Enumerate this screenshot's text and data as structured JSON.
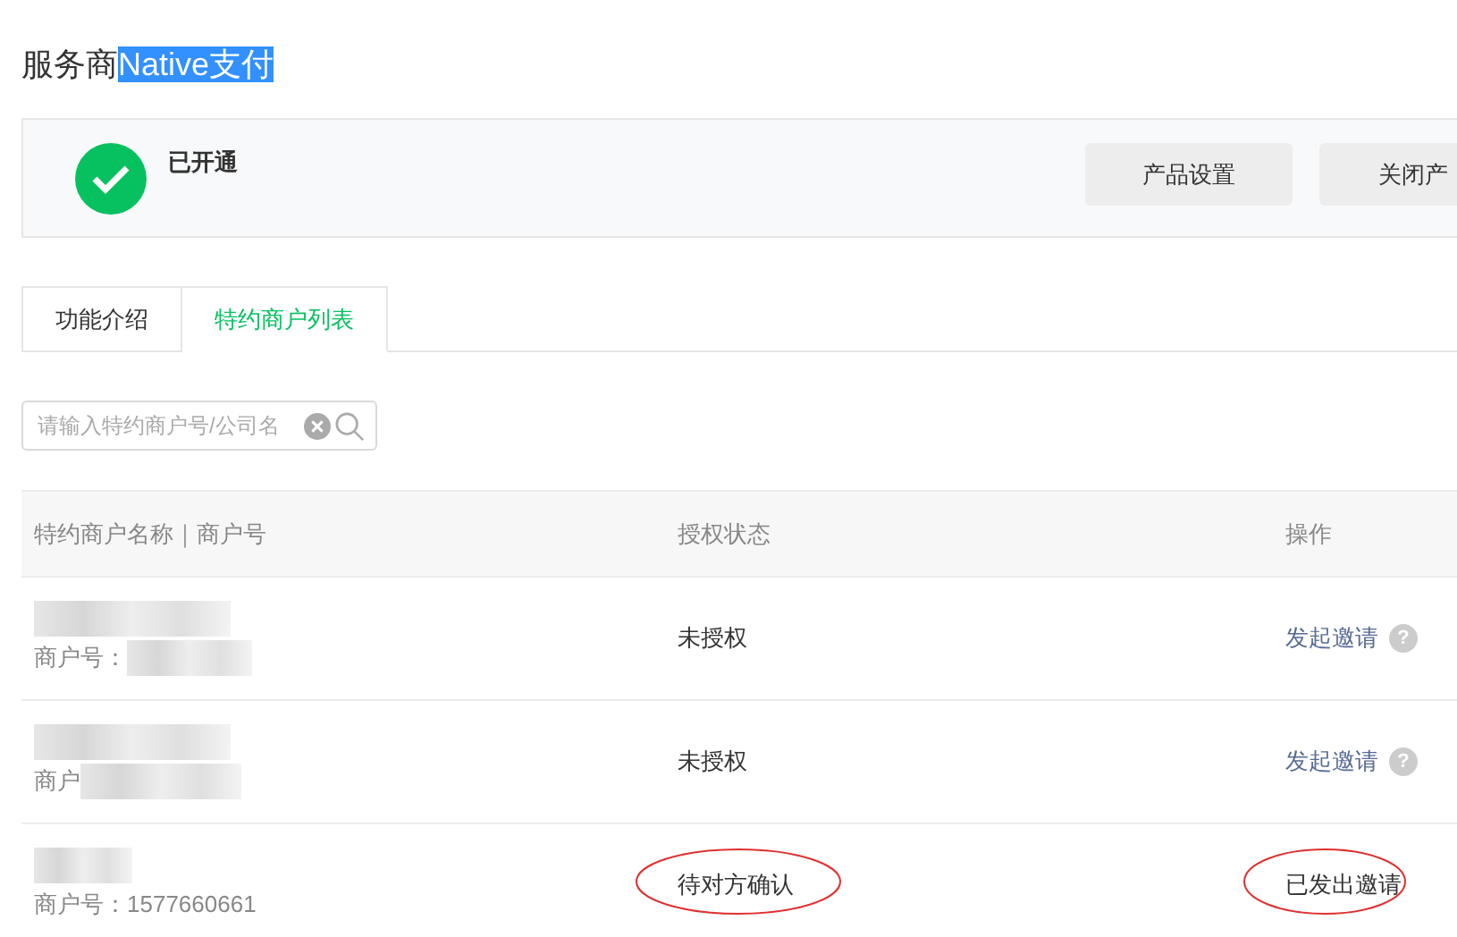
{
  "page_title": {
    "prefix": "服务商",
    "highlighted": "Native支付"
  },
  "status_panel": {
    "status": "已开通",
    "active": true,
    "buttons": [
      "产品设置",
      "关闭产"
    ]
  },
  "tabs": [
    {
      "label": "功能介绍",
      "selected": false
    },
    {
      "label": "特约商户列表",
      "selected": true
    }
  ],
  "search": {
    "placeholder": "请输入特约商户号/公司名"
  },
  "table": {
    "columns": [
      "特约商户名称｜商户号",
      "授权状态",
      "操作"
    ],
    "rows": [
      {
        "merchant_id": "商户号：",
        "status": "未授权",
        "action": {
          "kind": "link",
          "label": "发起邀请",
          "help": "?"
        },
        "circled": false
      },
      {
        "merchant_id": "商户",
        "status": "未授权",
        "action": {
          "kind": "link",
          "label": "发起邀请",
          "help": "?"
        },
        "circled": false
      },
      {
        "merchant_id": "商户号：1577660661",
        "status": "待对方确认",
        "action": {
          "kind": "text",
          "label": "已发出邀请"
        },
        "circled": true
      }
    ]
  }
}
